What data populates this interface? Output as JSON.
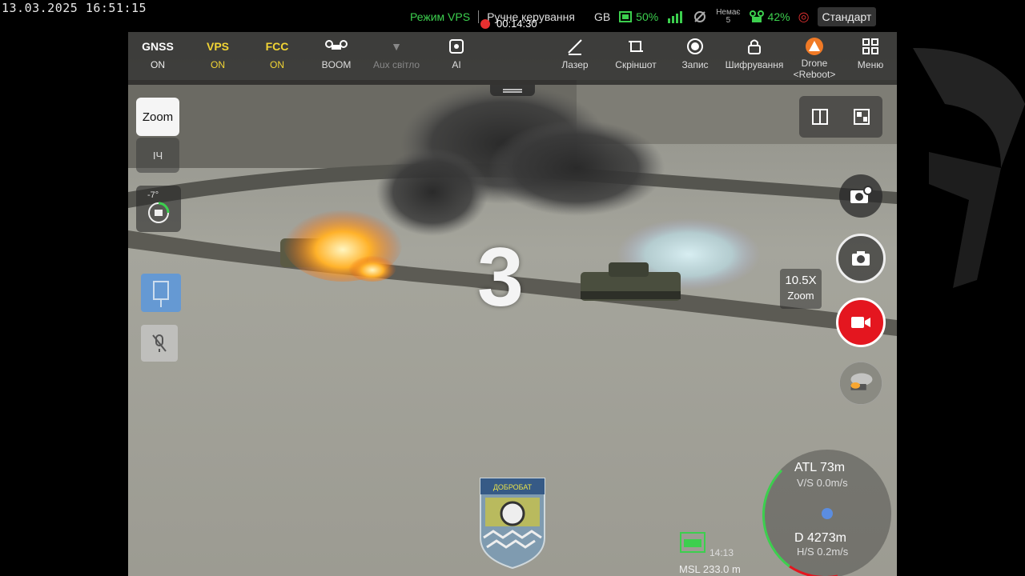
{
  "timestamp": "13.03.2025 16:51:15",
  "status_bar": {
    "mode": "Режим VPS",
    "control": "Ручне керування",
    "storage": "GB",
    "battery": "50%",
    "signal_sub": "Немає",
    "signal_sub2": "5",
    "drone_battery": "42%",
    "profile": "Стандарт",
    "rec_time": "00:14:30"
  },
  "toolbar": {
    "items": [
      {
        "icon": "GNSS",
        "label": "ON"
      },
      {
        "icon": "VPS",
        "label": "ON"
      },
      {
        "icon": "FCC",
        "label": "ON"
      },
      {
        "icon": "boom-icon",
        "label": "BOOM"
      },
      {
        "icon": "aux-light-icon",
        "label": "Aux світло"
      },
      {
        "icon": "ai-icon",
        "label": "AI"
      },
      {
        "icon": "laser-icon",
        "label": "Лазер"
      },
      {
        "icon": "screenshot-icon",
        "label": "Скріншот"
      },
      {
        "icon": "record-icon",
        "label": "Запис"
      },
      {
        "icon": "lock-icon",
        "label": "Шифрування"
      },
      {
        "icon": "warning-icon",
        "label": "Drone"
      },
      {
        "icon": "menu-icon",
        "label": "Меню"
      }
    ],
    "drone_sub": "<Reboot>"
  },
  "left_panel": {
    "zoom": "Zoom",
    "ir": "IЧ",
    "gimbal_angle": "-7°"
  },
  "right_panel": {
    "zoom_value": "10.5X",
    "zoom_label": "Zoom"
  },
  "overlay": {
    "big_number": "3"
  },
  "telemetry": {
    "atl": "ATL 73m",
    "vs": "V/S 0.0m/s",
    "distance": "D  4273m",
    "hs": "H/S 0.2m/s",
    "time": "14:13",
    "msl": "MSL 233.0 m"
  },
  "patch_text": "ДОБРОБАТ",
  "colors": {
    "accent_green": "#3ccf4e",
    "record_red": "#e4161f",
    "warning_orange": "#f07a26"
  }
}
